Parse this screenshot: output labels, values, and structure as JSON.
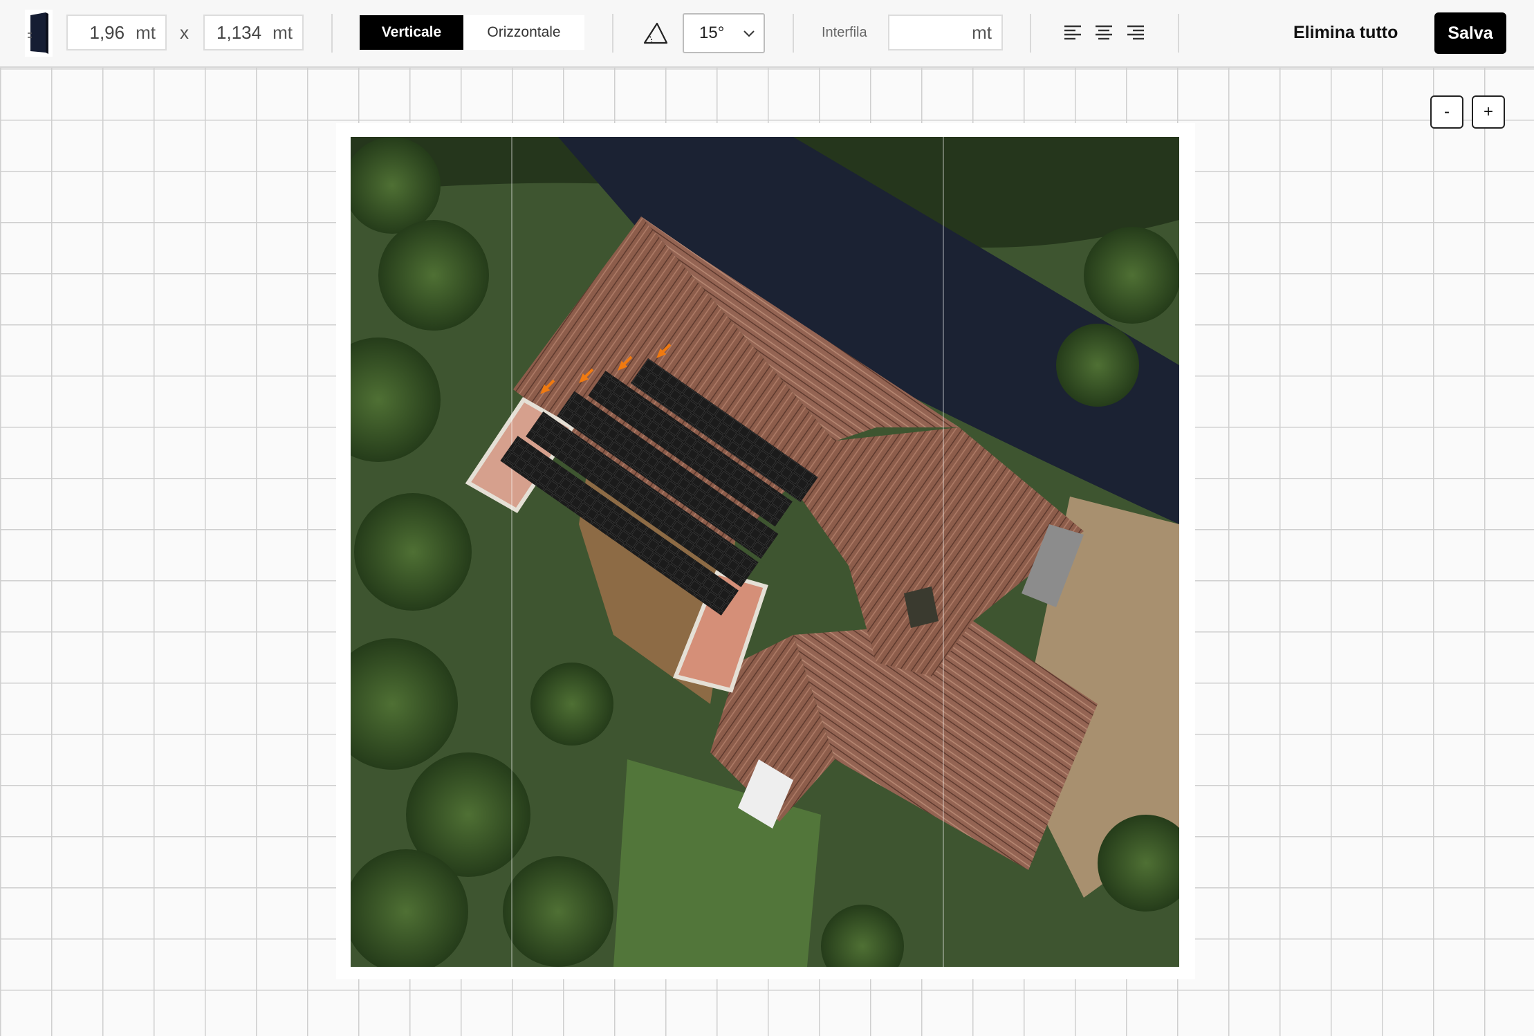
{
  "toolbar": {
    "panel_width": {
      "value": "1,96",
      "unit": "mt"
    },
    "times": "x",
    "panel_height": {
      "value": "1,134",
      "unit": "mt"
    },
    "orientation": {
      "options": [
        "Verticale",
        "Orizzontale"
      ],
      "selected": "Verticale"
    },
    "tilt": {
      "icon": "tilt-angle-icon",
      "value": "15°"
    },
    "interfila": {
      "label": "Interfila",
      "value": "",
      "unit": "mt"
    },
    "alignment_icons": [
      "align-left-icon",
      "align-center-icon",
      "align-right-icon"
    ],
    "clear_all": "Elimina tutto",
    "save": "Salva"
  },
  "zoom": {
    "out": "-",
    "in": "+"
  },
  "colors": {
    "accent": "#000000",
    "panel": "#111111",
    "arrow": "#f07a10",
    "roof": "#8f5e4c",
    "vegetation": "#3d5a2c"
  }
}
